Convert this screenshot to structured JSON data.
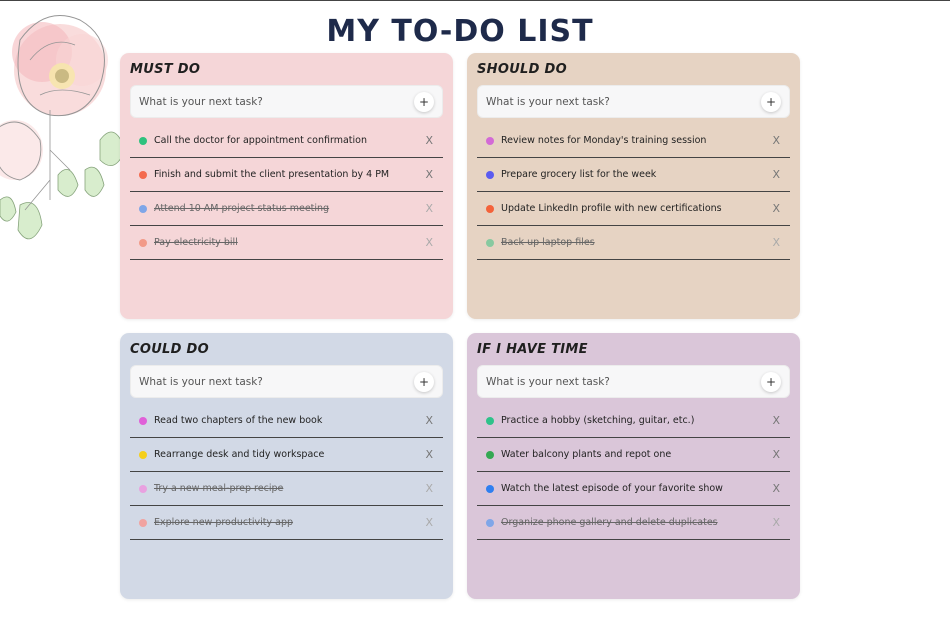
{
  "page": {
    "title": "MY TO-DO LIST"
  },
  "add_label": "+",
  "placeholder": "What is your next task?",
  "lists": [
    {
      "title": "MUST DO",
      "bg": "#f5d6d8",
      "tasks": [
        {
          "text": "Call the doctor for appointment confirmation",
          "color": "#2ec27e",
          "done": false,
          "delete": "X"
        },
        {
          "text": "Finish and submit the client presentation by 4 PM",
          "color": "#f46a4e",
          "done": false,
          "delete": "X"
        },
        {
          "text": "Attend 10 AM project status meeting",
          "color": "#7fa6e8",
          "done": true,
          "delete": "X"
        },
        {
          "text": "Pay electricity bill",
          "color": "#f29a88",
          "done": true,
          "delete": "X"
        }
      ]
    },
    {
      "title": "SHOULD DO",
      "bg": "#e6d3c3",
      "tasks": [
        {
          "text": "Review notes for Monday's training session",
          "color": "#d36ad6",
          "done": false,
          "delete": "X"
        },
        {
          "text": "Prepare grocery list for the week",
          "color": "#5b5bf0",
          "done": false,
          "delete": "X"
        },
        {
          "text": "Update LinkedIn profile with new certifications",
          "color": "#f4623a",
          "done": false,
          "delete": "X"
        },
        {
          "text": "Back up laptop files",
          "color": "#87c9a0",
          "done": true,
          "delete": "X"
        }
      ]
    },
    {
      "title": "COULD DO",
      "bg": "#d2d9e6",
      "tasks": [
        {
          "text": "Read two chapters of the new book",
          "color": "#e060d8",
          "done": false,
          "delete": "X"
        },
        {
          "text": "Rearrange desk and tidy workspace",
          "color": "#f5cf1a",
          "done": false,
          "delete": "X"
        },
        {
          "text": "Try a new meal-prep recipe",
          "color": "#e9a1e0",
          "done": true,
          "delete": "X"
        },
        {
          "text": "Explore new productivity app",
          "color": "#f1a3a0",
          "done": true,
          "delete": "X"
        }
      ]
    },
    {
      "title": "IF I HAVE TIME",
      "bg": "#dac6d9",
      "tasks": [
        {
          "text": "Practice a hobby (sketching, guitar, etc.)",
          "color": "#2ec28a",
          "done": false,
          "delete": "X"
        },
        {
          "text": "Water balcony plants and repot one",
          "color": "#34a853",
          "done": false,
          "delete": "X"
        },
        {
          "text": "Watch the latest episode of your favorite show",
          "color": "#2f7ff0",
          "done": false,
          "delete": "X"
        },
        {
          "text": "Organize phone gallery and delete duplicates",
          "color": "#7fa6e8",
          "done": true,
          "delete": "X"
        }
      ]
    }
  ]
}
